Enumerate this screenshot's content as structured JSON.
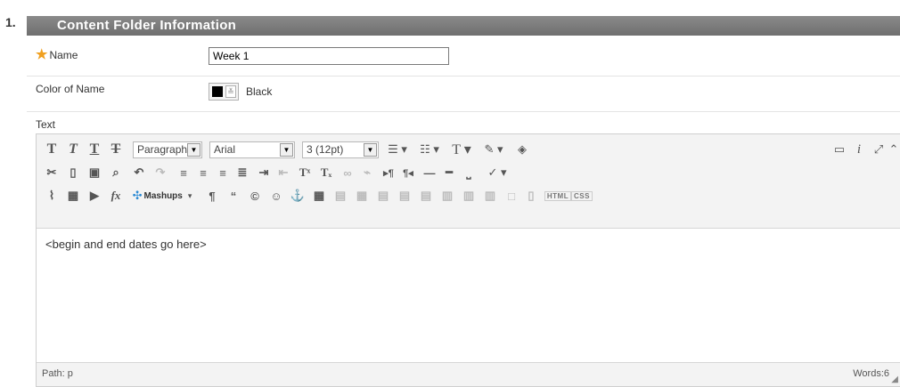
{
  "step": {
    "number": "1."
  },
  "section": {
    "title": "Content Folder Information"
  },
  "name_field": {
    "label": "Name",
    "value": "Week 1",
    "required": true
  },
  "color_field": {
    "label": "Color of Name",
    "swatch_color": "#000000",
    "value": "Black"
  },
  "text_field": {
    "label": "Text"
  },
  "toolbar": {
    "paragraph_select": "Paragraph",
    "font_select": "Arial",
    "size_select": "3 (12pt)",
    "mashups_label": "Mashups",
    "html_label": "HTML",
    "css_label": "CSS"
  },
  "editor": {
    "content": "<begin and end dates go here>"
  },
  "statusbar": {
    "path": "Path: p",
    "words": "Words:6"
  }
}
